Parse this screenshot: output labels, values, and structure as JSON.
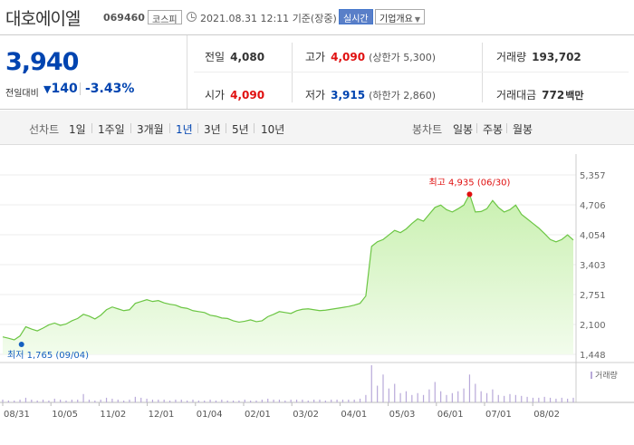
{
  "header": {
    "stock_name": "대호에이엘",
    "stock_code": "069460",
    "market": "코스피",
    "datetime": "2021.08.31 12:11",
    "status": "기준(장중)",
    "realtime_label": "실시간",
    "company_label": "기업개요"
  },
  "quote": {
    "price": "3,940",
    "change_label": "전일대비",
    "change_abs": "140",
    "change_pct": "-3.43%",
    "prev_close_label": "전일",
    "prev_close": "4,080",
    "open_label": "시가",
    "open": "4,090",
    "high_label": "고가",
    "high": "4,090",
    "upper_limit": "(상한가 5,300)",
    "low_label": "저가",
    "low": "3,915",
    "lower_limit": "(하한가 2,860)",
    "volume_label": "거래량",
    "volume": "193,702",
    "amount_label": "거래대금",
    "amount": "772",
    "amount_unit": "백만"
  },
  "tabs": {
    "line_label": "선차트",
    "line_tabs": [
      "1일",
      "1주일",
      "3개월",
      "1년",
      "3년",
      "5년",
      "10년"
    ],
    "active_tab": "1년",
    "candle_label": "봉차트",
    "candle_tabs": [
      "일봉",
      "주봉",
      "월봉"
    ]
  },
  "colors": {
    "line": "#6cc644",
    "fill_top": "#c9f0b0",
    "fill_bottom": "#f2fcec",
    "max_marker": "#e01010",
    "min_marker": "#1560c0",
    "volume": "#b8a9d9"
  },
  "chart_data": {
    "type": "area",
    "y_ticks": [
      "5,357",
      "4,706",
      "4,054",
      "3,403",
      "2,751",
      "2,100",
      "1,448"
    ],
    "ylim": [
      1448,
      5357
    ],
    "x_labels": [
      "08/31",
      "10/05",
      "11/02",
      "12/01",
      "01/04",
      "02/01",
      "03/02",
      "04/01",
      "05/03",
      "06/01",
      "07/01",
      "08/02"
    ],
    "max_annotation": "최고 4,935 (06/30)",
    "min_annotation": "최저 1,765 (09/04)",
    "volume_legend": "거래량",
    "series": [
      {
        "values": [
          1830,
          1800,
          1765,
          1850,
          2050,
          2000,
          1960,
          2020,
          2090,
          2130,
          2080,
          2110,
          2180,
          2230,
          2320,
          2280,
          2220,
          2300,
          2420,
          2480,
          2440,
          2400,
          2420,
          2560,
          2600,
          2640,
          2600,
          2620,
          2570,
          2540,
          2520,
          2470,
          2450,
          2400,
          2380,
          2360,
          2300,
          2280,
          2240,
          2230,
          2180,
          2150,
          2170,
          2200,
          2160,
          2180,
          2270,
          2320,
          2380,
          2360,
          2340,
          2400,
          2430,
          2440,
          2420,
          2400,
          2410,
          2430,
          2450,
          2470,
          2490,
          2520,
          2560,
          2720,
          3800,
          3900,
          3950,
          4050,
          4150,
          4100,
          4180,
          4300,
          4400,
          4350,
          4500,
          4650,
          4700,
          4600,
          4550,
          4620,
          4700,
          4935,
          4550,
          4560,
          4620,
          4800,
          4650,
          4550,
          4600,
          4700,
          4500,
          4400,
          4300,
          4200,
          4080,
          3950,
          3900,
          3950,
          4050,
          3940
        ],
        "volume": [
          3,
          2,
          2,
          3,
          5,
          3,
          2,
          3,
          2,
          4,
          3,
          2,
          3,
          3,
          9,
          3,
          2,
          3,
          5,
          4,
          3,
          2,
          3,
          6,
          5,
          4,
          3,
          3,
          3,
          2,
          3,
          3,
          2,
          3,
          2,
          2,
          3,
          2,
          3,
          2,
          2,
          2,
          3,
          2,
          2,
          3,
          4,
          3,
          3,
          2,
          3,
          3,
          3,
          2,
          3,
          3,
          2,
          3,
          3,
          3,
          3,
          3,
          4,
          8,
          40,
          18,
          30,
          15,
          20,
          10,
          12,
          8,
          10,
          8,
          14,
          22,
          12,
          8,
          10,
          12,
          15,
          30,
          20,
          12,
          10,
          14,
          8,
          7,
          9,
          8,
          7,
          6,
          5,
          5,
          6,
          5,
          4,
          5,
          4,
          5
        ]
      }
    ]
  }
}
